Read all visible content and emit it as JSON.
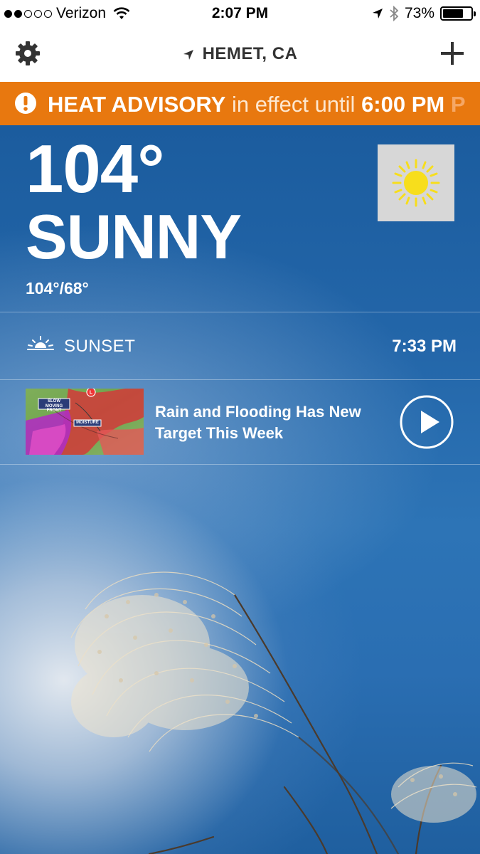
{
  "status_bar": {
    "signal_filled": 2,
    "signal_total": 5,
    "carrier": "Verizon",
    "time": "2:07 PM",
    "battery_percent": "73%",
    "battery_level": 0.73
  },
  "nav": {
    "location": "HEMET, CA",
    "icons": [
      "gear-icon",
      "location-arrow-icon",
      "plus-icon"
    ]
  },
  "advisory": {
    "title": "HEAT ADVISORY",
    "middle": "in effect until",
    "time": "6:00 PM",
    "overflow": "P",
    "color": "#e8780f",
    "icon": "alert-icon"
  },
  "current": {
    "temperature": "104°",
    "condition": "SUNNY",
    "hi_lo": "104°/68°",
    "icon": "sun-icon"
  },
  "sunset": {
    "label": "SUNSET",
    "time": "7:33 PM",
    "icon": "sunset-icon"
  },
  "video": {
    "title": "Rain and Flooding Has New Target This Week",
    "thumb_labels": [
      "SLOW MOVING FRONT",
      "MOISTURE"
    ],
    "icon": "play-icon"
  }
}
